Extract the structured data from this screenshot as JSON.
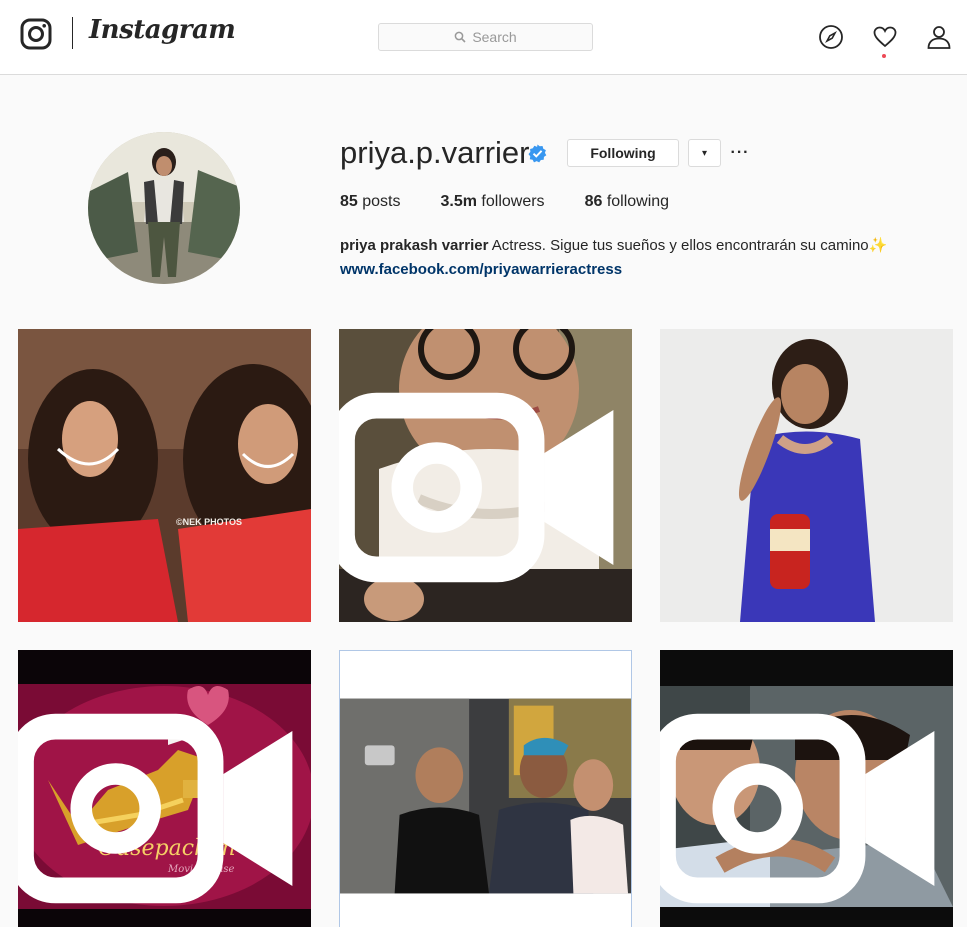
{
  "nav": {
    "logo_text": "Instagram",
    "search_placeholder": "Search",
    "icons": [
      "instagram-camera-icon",
      "search-icon",
      "compass-icon",
      "heart-icon",
      "user-icon"
    ],
    "notification_dot_color": "#ed4956"
  },
  "profile": {
    "username": "priya.p.varrier",
    "verified": true,
    "following_label": "Following",
    "dropdown_glyph": "▾",
    "more_glyph": "···",
    "stats": {
      "posts_count": "85",
      "posts_label": "posts",
      "followers_count": "3.5m",
      "followers_label": "followers",
      "following_count": "86",
      "following_label": "following"
    },
    "full_name": "priya prakash varrier",
    "bio": "Actress. Sigue tus sueños y ellos encontrarán su camino",
    "bio_emoji": "✨",
    "link": "www.facebook.com/priyawarrieractress"
  },
  "posts": [
    {
      "watermark": "©NEK PHOTOS",
      "video": false
    },
    {
      "video": true
    },
    {
      "video": false
    },
    {
      "video": true,
      "title": "Ousepachan",
      "subtitle": "Movie House"
    },
    {
      "video": false
    },
    {
      "video": true
    }
  ],
  "colors": {
    "link": "#003569",
    "verified": "#3897f0",
    "border": "#dbdbdb"
  }
}
